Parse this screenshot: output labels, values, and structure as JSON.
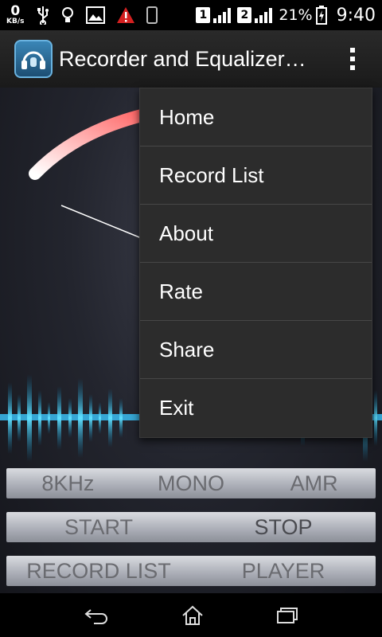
{
  "status_bar": {
    "net_speed": "0",
    "net_unit": "KB/s",
    "sim1": "1",
    "sim2": "2",
    "battery_pct": "21%",
    "time": "9:40",
    "icons": [
      "usb-icon",
      "bulb-icon",
      "image-icon",
      "warning-icon",
      "phone-icon",
      "signal-icon",
      "battery-charging-icon"
    ]
  },
  "action_bar": {
    "title": "Recorder and Equalizer…",
    "icon": "app-icon",
    "overflow_icon": "overflow-menu-icon"
  },
  "menu": {
    "items": [
      "Home",
      "Record List",
      "About",
      "Rate",
      "Share",
      "Exit"
    ]
  },
  "settings_row": {
    "sample_rate": "8KHz",
    "channel": "MONO",
    "format": "AMR"
  },
  "record_row": {
    "start": "START",
    "stop": "STOP"
  },
  "nav_row": {
    "record_list": "RECORD LIST",
    "player": "PLAYER"
  },
  "nav_bar": {
    "icons": [
      "back-icon",
      "home-icon",
      "recent-apps-icon"
    ]
  },
  "colors": {
    "wave": "#3cc8ff",
    "gauge_arc": "#f5c8c8",
    "menu_bg": "#2c2c2c"
  }
}
